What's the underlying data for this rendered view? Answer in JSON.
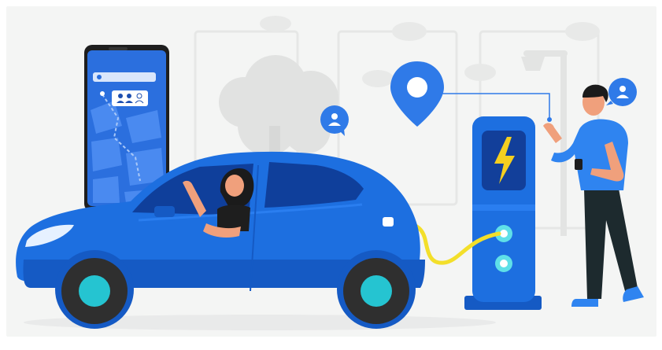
{
  "scene": {
    "description_free": true,
    "colors": {
      "background": "#f4f5f4",
      "bg_tree": "#e3e4e3",
      "bg_frame": "#e9eae9",
      "car_body": "#1d6fe0",
      "car_body_dark": "#155ac4",
      "car_window": "#0f3f9b",
      "wheel": "#2f2f2f",
      "hubcap": "#25c4d1",
      "phone_frame": "#1e1e1e",
      "phone_screen": "#2b6fde",
      "phone_map_block": "#4a8af0",
      "charger_body": "#1d6fe0",
      "charger_panel": "#123f9a",
      "bolt": "#f4cf1f",
      "cable": "#f3df2a",
      "socket": "#5fe0e8",
      "pin": "#2f7ae8",
      "person_shirt": "#2f84f0",
      "person_pants": "#1d2a2e",
      "skin": "#f0a07c",
      "hair": "#1b1b1b",
      "shoe": "#2f84f0"
    },
    "icons": [
      "location-pin-icon",
      "user-badge-icon",
      "lightning-bolt-icon",
      "map-route-icon",
      "group-icon"
    ]
  }
}
